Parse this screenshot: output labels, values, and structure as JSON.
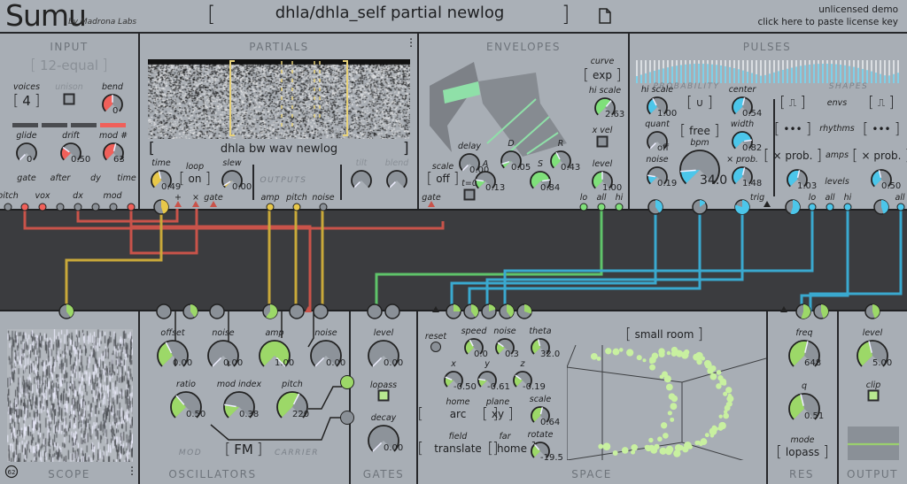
{
  "header": {
    "logo": "Sumu",
    "byline": "by Madrona Labs",
    "preset": "dhla/dhla_self partial newlog",
    "file_icon": "document-icon",
    "license_line1": "unlicensed demo",
    "license_line2": "click here to paste license key"
  },
  "colors": {
    "input": "#f0605a",
    "partials": "#e8c84a",
    "envelopes": "#7fe07a",
    "pulses": "#4cc6ea",
    "bottom": "#9cd868",
    "patch_bay": "#3b3c3f",
    "panel": "#a8aeb5"
  },
  "input": {
    "title": "INPUT",
    "scale": "12-equal",
    "voices_label": "voices",
    "voices": "4",
    "unison_label": "unison",
    "bend": {
      "label": "bend",
      "value": "0",
      "level": 0.5,
      "color": "#f0605a"
    },
    "glide": {
      "label": "glide",
      "value": "0",
      "level": 0,
      "color": "#f0605a"
    },
    "drift": {
      "label": "drift",
      "value": "0.50",
      "level": 0.3,
      "color": "#f0605a"
    },
    "mod": {
      "label": "mod #",
      "value": "63",
      "level": 0.55,
      "color": "#f0605a"
    },
    "ports": {
      "pitch": "pitch",
      "gate": "gate",
      "vox": "vox",
      "after": "after",
      "dx": "dx",
      "dy": "dy",
      "mod": "mod",
      "time": "time"
    }
  },
  "partials": {
    "title": "PARTIALS",
    "menu_icon": "kebab-menu-icon",
    "file": "dhla bw wav newlog",
    "time": {
      "label": "time",
      "value": "0.49",
      "level": 0.45,
      "color": "#e8c84a"
    },
    "loop_label": "loop",
    "loop": "on",
    "slew": {
      "label": "slew",
      "value": "0.00",
      "level": 0.05,
      "color": "#e8c84a"
    },
    "outputs_label": "OUTPUTS",
    "tilt": {
      "label": "tilt",
      "value": "",
      "level": 0,
      "color": "#9aa0a7"
    },
    "blend": {
      "label": "blend",
      "value": "",
      "level": 0,
      "color": "#9aa0a7"
    },
    "ports": {
      "plus": "+",
      "times": "×",
      "gate": "gate",
      "amp": "amp",
      "pitch": "pitch",
      "noise": "noise"
    }
  },
  "envelopes": {
    "title": "ENVELOPES",
    "curve_label": "curve",
    "curve": "exp",
    "hi_scale": {
      "label": "hi scale",
      "value": "2.63",
      "level": 0.65,
      "color": "#7fe07a"
    },
    "x_vel_label": "x vel",
    "delay": {
      "label": "delay",
      "value": "0.00",
      "level": 0,
      "color": "#7fe07a"
    },
    "d": {
      "label": "D",
      "value": "0.05",
      "level": 0.1,
      "color": "#7fe07a"
    },
    "r": {
      "label": "R",
      "value": "0.43",
      "level": 0.4,
      "color": "#7fe07a"
    },
    "scale_label": "scale",
    "scale": "off",
    "a": {
      "label": "A",
      "value": "0.13",
      "level": 0.2,
      "color": "#7fe07a"
    },
    "s": {
      "label": "S",
      "value": "0.84",
      "level": 0.8,
      "color": "#7fe07a"
    },
    "level": {
      "label": "level",
      "value": "1.00",
      "level": 0.5,
      "color": "#7fe07a"
    },
    "t0_label": "t=0",
    "ports": {
      "gate": "gate",
      "lo": "lo",
      "all": "all",
      "hi": "hi"
    }
  },
  "pulses": {
    "title": "PULSES",
    "probability_label": "PROBABILITY",
    "shapes_label": "SHAPES",
    "hi_scale": {
      "label": "hi scale",
      "value": "1.00",
      "level": 0.4,
      "color": "#4cc6ea"
    },
    "curve_shape": "∪",
    "center": {
      "label": "center",
      "value": "0.54",
      "level": 0.55,
      "color": "#4cc6ea"
    },
    "quant": {
      "label": "quant",
      "value": "off",
      "level": 0,
      "color": "#4cc6ea"
    },
    "sync": "free",
    "width": {
      "label": "width",
      "value": "0.82",
      "level": 0.8,
      "color": "#4cc6ea"
    },
    "noise": {
      "label": "noise",
      "value": "0.19",
      "level": 0.2,
      "color": "#4cc6ea"
    },
    "bpm": {
      "label": "bpm",
      "value": "34.0",
      "level": 0.15,
      "color": "#4cc6ea"
    },
    "x_prob": {
      "label": "× prob.",
      "value": "1.48",
      "level": 0.55,
      "color": "#4cc6ea"
    },
    "envs_label": "envs",
    "envs_left": "⎍",
    "envs_right": "⎍",
    "rhythms_label": "rhythms",
    "rhythms_left": "•••",
    "rhythms_right": "•••",
    "amps_label": "amps",
    "amps_left": "× prob.",
    "amps_right": "× prob.",
    "levels_label": "levels",
    "level_left": {
      "label": "",
      "value": "1.03",
      "level": 0.55,
      "color": "#4cc6ea"
    },
    "level_right": {
      "label": "",
      "value": "0.50",
      "level": 0.45,
      "color": "#4cc6ea"
    },
    "ports": {
      "trig": "trig",
      "lo": "lo",
      "all": "all",
      "hi": "hi",
      "all2": "all"
    }
  },
  "scope": {
    "title": "SCOPE",
    "menu_icon": "kebab-menu-icon",
    "logo_icon": "madrona-logo-icon"
  },
  "oscillators": {
    "title": "OSCILLATORS",
    "offset": {
      "label": "offset",
      "value": "0.00",
      "level": 0.4,
      "color": "#9cd868"
    },
    "mod_noise": {
      "label": "noise",
      "value": "0.00",
      "level": 0,
      "color": "#9cd868"
    },
    "amp": {
      "label": "amp",
      "value": "1.00",
      "level": 1,
      "color": "#9cd868"
    },
    "carrier_noise": {
      "label": "noise",
      "value": "0.00",
      "level": 0,
      "color": "#9cd868"
    },
    "ratio": {
      "label": "ratio",
      "value": "0.50",
      "level": 0.35,
      "color": "#9cd868"
    },
    "mod_index": {
      "label": "mod index",
      "value": "0.38",
      "level": 0.2,
      "color": "#9cd868"
    },
    "pitch": {
      "label": "pitch",
      "value": "220",
      "level": 0.6,
      "color": "#9cd868"
    },
    "mod_label": "MOD",
    "mode": "FM",
    "carrier_label": "CARRIER"
  },
  "gates": {
    "title": "GATES",
    "level": {
      "label": "level",
      "value": "0.00",
      "level": 0,
      "color": "#9cd868"
    },
    "lopass_label": "lopass",
    "decay": {
      "label": "decay",
      "value": "0.00",
      "level": 0,
      "color": "#9cd868"
    }
  },
  "space": {
    "title": "SPACE",
    "reset_label": "reset",
    "room": "small room",
    "speed": {
      "label": "speed",
      "value": "0.0",
      "level": 0.4,
      "color": "#9cd868"
    },
    "noise": {
      "label": "noise",
      "value": "0.3",
      "level": 0.3,
      "color": "#9cd868"
    },
    "theta": {
      "label": "theta",
      "value": "32.0",
      "level": 0.45,
      "color": "#9cd868"
    },
    "x": {
      "label": "x",
      "value": "-0.50",
      "level": 0.25,
      "color": "#9cd868"
    },
    "y": {
      "label": "y",
      "value": "-0.61",
      "level": 0.2,
      "color": "#9cd868"
    },
    "z": {
      "label": "z",
      "value": "-0.19",
      "level": 0.3,
      "color": "#9cd868"
    },
    "home_label": "home",
    "home": "arc",
    "plane_label": "plane",
    "plane": "xy",
    "scale": {
      "label": "scale",
      "value": "0.64",
      "level": 0.55,
      "color": "#9cd868"
    },
    "field_label": "field",
    "field": "translate",
    "far_label": "far",
    "far": "home",
    "rotate": {
      "label": "rotate",
      "value": "-19.5",
      "level": 0.35,
      "color": "#9cd868"
    }
  },
  "res": {
    "title": "RES",
    "freq": {
      "label": "freq",
      "value": "648",
      "level": 0.55,
      "color": "#9cd868"
    },
    "q": {
      "label": "q",
      "value": "0.51",
      "level": 0.45,
      "color": "#9cd868"
    },
    "mode_label": "mode",
    "mode": "lopass"
  },
  "output": {
    "title": "OUTPUT",
    "level": {
      "label": "level",
      "value": "5.00",
      "level": 0.45,
      "color": "#9cd868"
    },
    "clip_label": "clip"
  }
}
